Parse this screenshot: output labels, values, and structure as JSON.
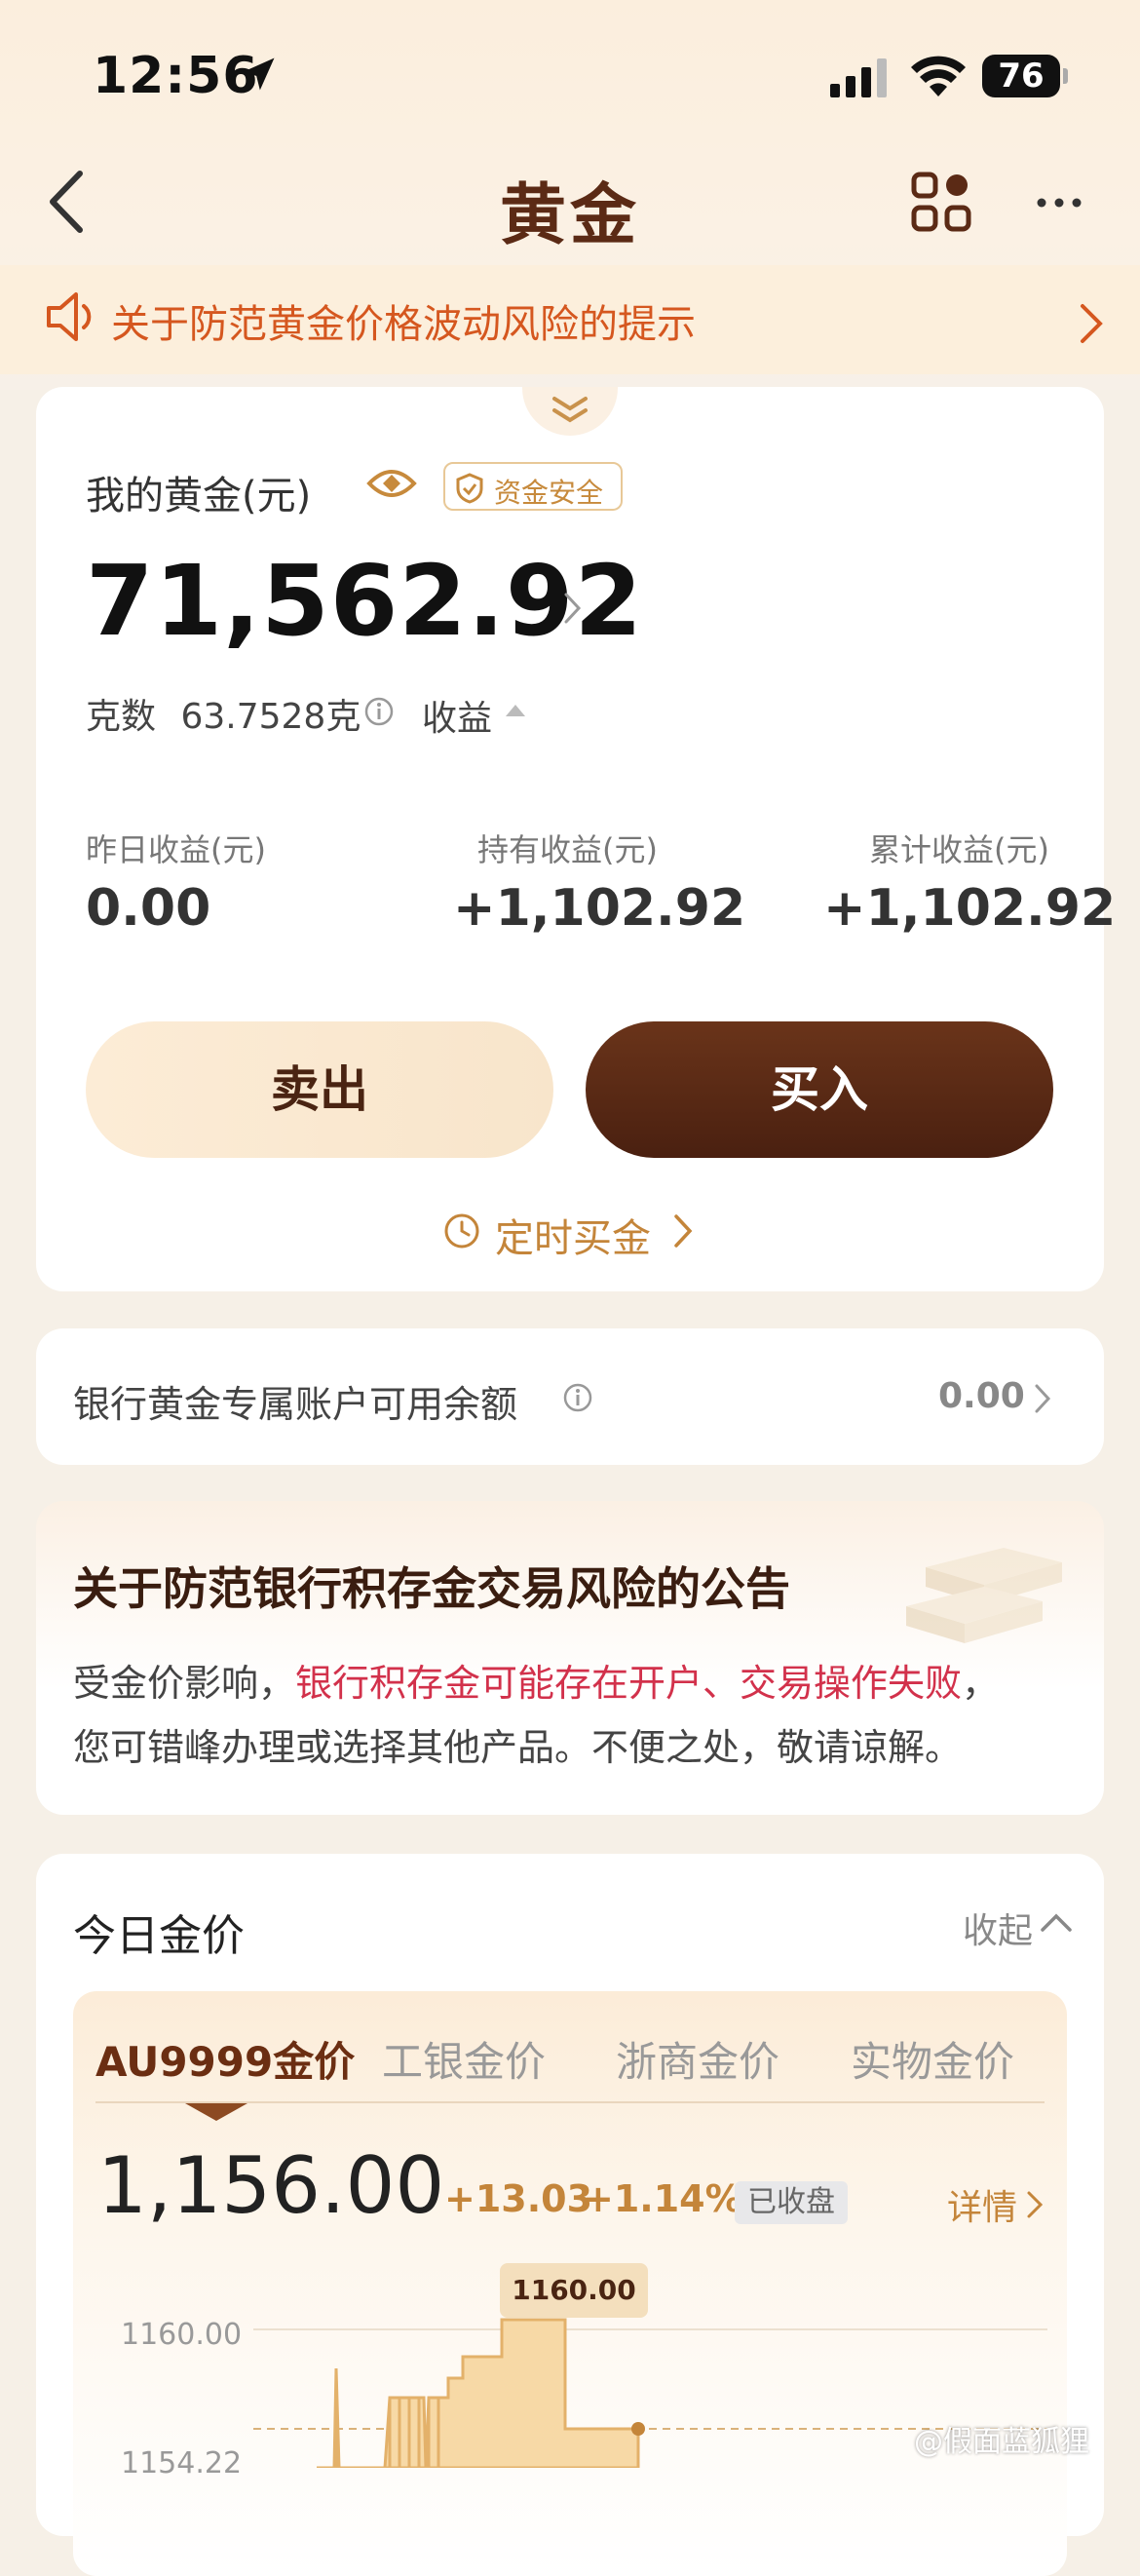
{
  "status_bar": {
    "time": "12:56",
    "battery": "76"
  },
  "nav": {
    "title": "黄金"
  },
  "notice": {
    "text": "关于防范黄金价格波动风险的提示"
  },
  "holding": {
    "label": "我的黄金(元)",
    "safe_badge": "资金安全",
    "amount": "71,562.92",
    "grams_label": "克数",
    "grams_value": "63.7528克",
    "earnings_toggle": "收益",
    "stats": [
      {
        "label": "昨日收益(元)",
        "value": "0.00"
      },
      {
        "label": "持有收益(元)",
        "value": "+1,102.92"
      },
      {
        "label": "累计收益(元)",
        "value": "+1,102.92"
      }
    ],
    "sell_label": "卖出",
    "buy_label": "买入",
    "scheduled_label": "定时买金"
  },
  "account": {
    "label": "银行黄金专属账户可用余额",
    "value": "0.00"
  },
  "announcement": {
    "title": "关于防范银行积存金交易风险的公告",
    "line1_prefix": "受金价影响，",
    "line1_highlight": "银行积存金可能存在开户、交易操作失败",
    "line1_suffix": "，",
    "line2": "您可错峰办理或选择其他产品。不便之处，敬请谅解。"
  },
  "today_price": {
    "title": "今日金价",
    "collapse_label": "收起",
    "tabs": [
      "AU9999金价",
      "工银金价",
      "浙商金价",
      "实物金价"
    ],
    "active_tab": 0,
    "price": "1,156.00",
    "change": "+13.03",
    "change_pct": "+1.14%",
    "status": "已收盘",
    "detail_label": "详情",
    "chart": {
      "y_ticks": [
        "1160.00",
        "1154.22"
      ],
      "tooltip": "1160.00"
    }
  },
  "watermark": "@假面蓝狐狸",
  "colors": {
    "accent": "#c4853a",
    "brand_dark": "#5b2a15",
    "warning": "#d5571f",
    "highlight_red": "#d2314b"
  }
}
